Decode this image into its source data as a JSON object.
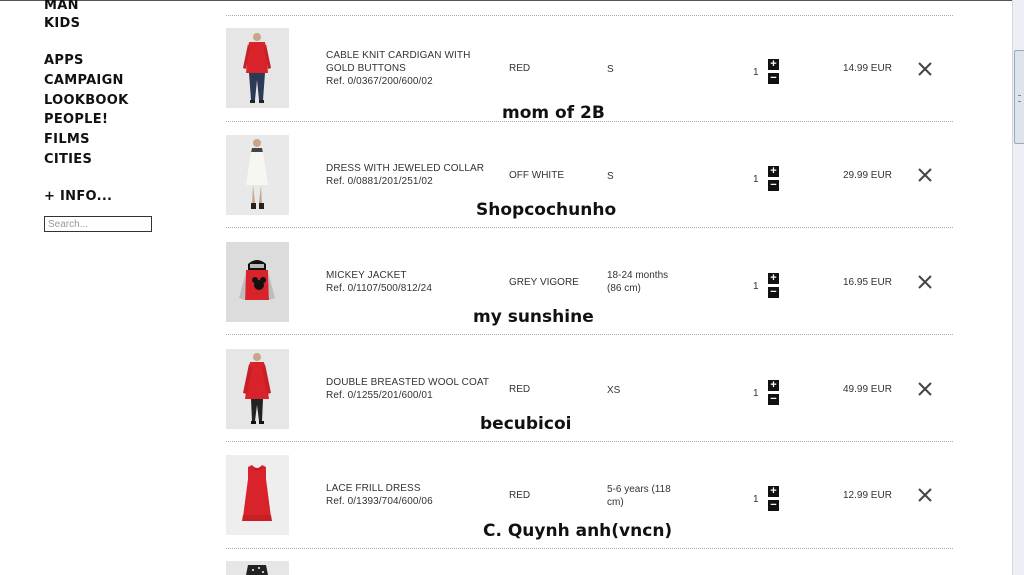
{
  "nav": {
    "man": "MAN",
    "kids": "KIDS",
    "items": [
      "APPS",
      "CAMPAIGN",
      "LOOKBOOK",
      "PEOPLE!",
      "FILMS",
      "CITIES"
    ],
    "info": "+ INFO...",
    "search_placeholder": "Search..."
  },
  "cart": {
    "items": [
      {
        "name": "CABLE KNIT CARDIGAN WITH\nGOLD BUTTONS",
        "ref": "Ref. 0/0367/200/600/02",
        "color": "RED",
        "size": "S",
        "qty": "1",
        "price": "14.99 EUR",
        "caption": "mom of 2B",
        "thumb": "red-cardigan"
      },
      {
        "name": "DRESS WITH JEWELED COLLAR",
        "ref": "Ref. 0/0881/201/251/02",
        "color": "OFF WHITE",
        "size": "S",
        "qty": "1",
        "price": "29.99 EUR",
        "caption": "Shopcochunho",
        "thumb": "white-dress"
      },
      {
        "name": "MICKEY JACKET",
        "ref": "Ref. 0/1107/500/812/24",
        "color": "GREY VIGORE",
        "size": "18-24 months\n(86 cm)",
        "qty": "1",
        "price": "16.95 EUR",
        "caption": "my sunshine",
        "thumb": "mickey-jacket"
      },
      {
        "name": "DOUBLE BREASTED WOOL COAT",
        "ref": "Ref. 0/1255/201/600/01",
        "color": "RED",
        "size": "XS",
        "qty": "1",
        "price": "49.99 EUR",
        "caption": "becubicoi",
        "thumb": "red-coat"
      },
      {
        "name": "LACE FRILL DRESS",
        "ref": "Ref. 0/1393/704/600/06",
        "color": "RED",
        "size": "5-6 years (118\ncm)",
        "qty": "1",
        "price": "12.99 EUR",
        "caption": "C. Quynh anh(vncn)",
        "thumb": "red-dress"
      }
    ],
    "plus_label": "+",
    "minus_label": "−"
  },
  "colors": {
    "caption": "#111111",
    "garment_red": "#d8232a",
    "divider": "#aaaaaa"
  }
}
